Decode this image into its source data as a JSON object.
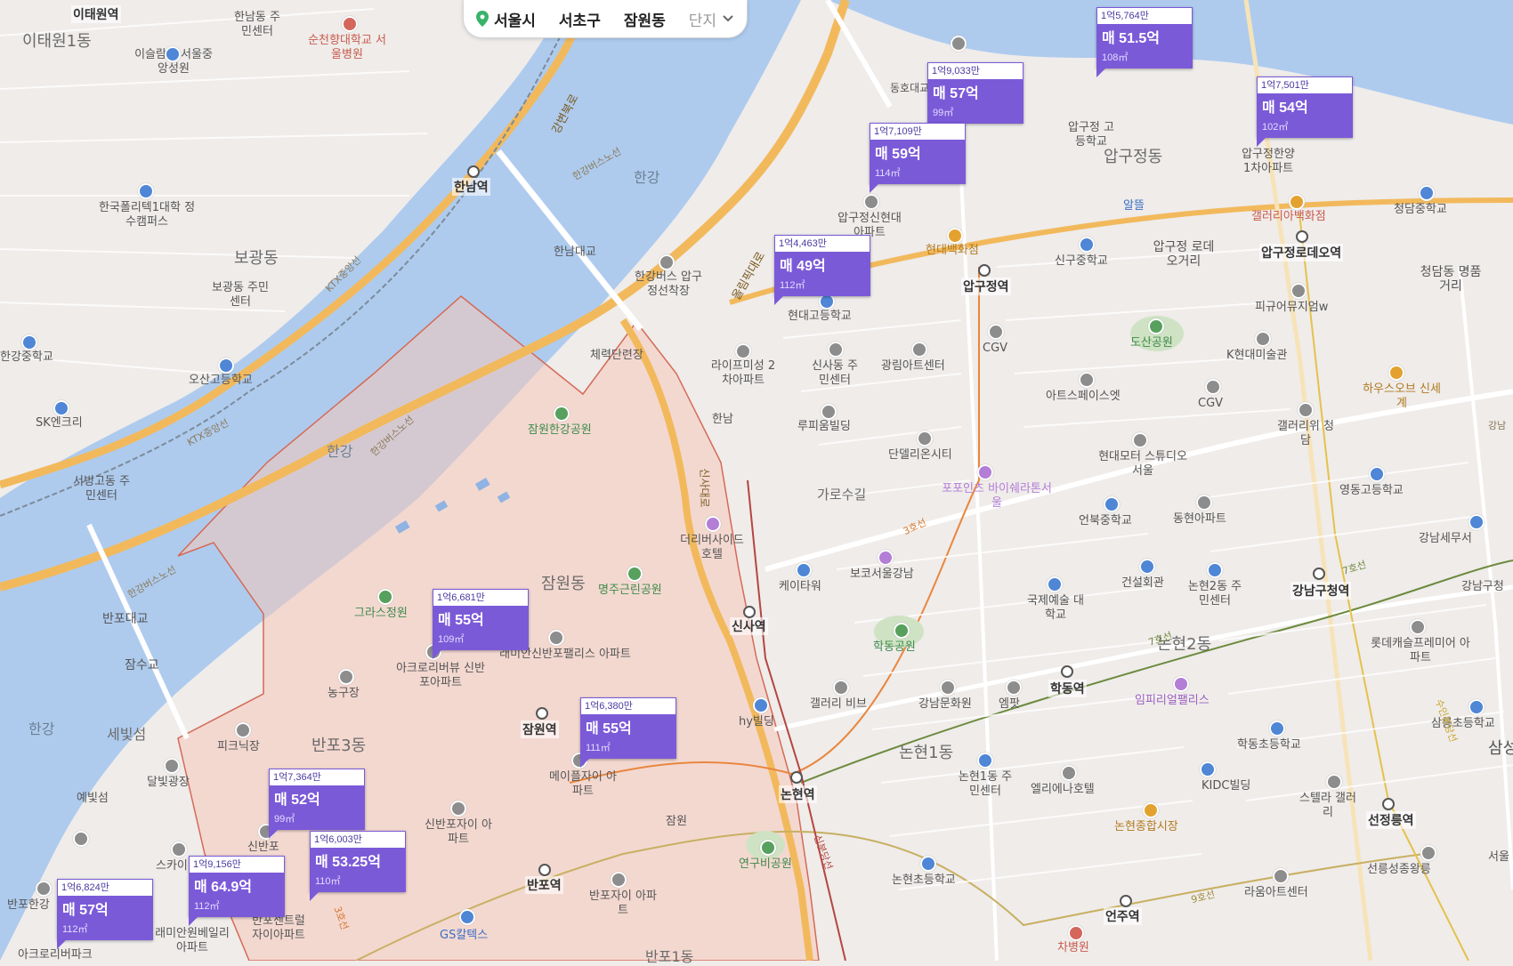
{
  "search": {
    "crumbs": [
      "서울시",
      "서초구",
      "잠원동",
      "단지"
    ]
  },
  "colors": {
    "water": "#aecbee",
    "land": "#efecea",
    "road_major": "#f2b95c",
    "district_fill": "#f6c9b9",
    "card": "#7b5ad8"
  },
  "listings": [
    {
      "per_pyeong": "1억5,764만",
      "price": "매 51.5억",
      "size": "108㎡"
    },
    {
      "per_pyeong": "1억9,033만",
      "price": "매 57억",
      "size": "99㎡"
    },
    {
      "per_pyeong": "1억7,501만",
      "price": "매 54억",
      "size": "102㎡"
    },
    {
      "per_pyeong": "1억7,109만",
      "price": "매 59억",
      "size": "114㎡"
    },
    {
      "per_pyeong": "1억4,463만",
      "price": "매 49억",
      "size": "112㎡"
    },
    {
      "per_pyeong": "1억6,681만",
      "price": "매 55억",
      "size": "109㎡"
    },
    {
      "per_pyeong": "1억6,380만",
      "price": "매 55억",
      "size": "111㎡"
    },
    {
      "per_pyeong": "1억7,364만",
      "price": "매 52억",
      "size": "99㎡"
    },
    {
      "per_pyeong": "1억6,003만",
      "price": "매 53.25억",
      "size": "110㎡"
    },
    {
      "per_pyeong": "1억9,156만",
      "price": "매 64.9억",
      "size": "112㎡"
    },
    {
      "per_pyeong": "1억6,824만",
      "price": "매 57억",
      "size": "112㎡"
    }
  ],
  "labels": {
    "areas": [
      "이태원1동",
      "보광동",
      "한강",
      "한강",
      "잠원동",
      "반포3동",
      "압구정동",
      "논현2동",
      "논현1동",
      "가로수길",
      "세빛섬",
      "한강",
      "반포1동"
    ],
    "stations": [
      "이태원역",
      "한남역",
      "압구정역",
      "신사역",
      "잠원역",
      "논현역",
      "학동역",
      "강남구청역",
      "선정릉역",
      "반포역",
      "언주역",
      "압구정로데오역"
    ],
    "pois": [
      "한남동 주민센터",
      "이슬람교 서울중앙성원",
      "순천향대학교 서울병원",
      "한국폴리텍1대학 정수캠퍼스",
      "보광동 주민센터",
      "한강중학교",
      "오산고등학교",
      "SK엔크리",
      "서빙고동 주민센터",
      "한남대교",
      "한강버스 압구정선착장",
      "현대고등학교",
      "라이프미성 2차아파트",
      "신사동 주민센터",
      "광림아트센터",
      "루피움빌딩",
      "단델리온시티",
      "체력단련장",
      "잠원한강공원",
      "더리버사이드 호텔",
      "명주근린공원",
      "래미안신반포팰리스 아파트",
      "그라스정원",
      "아크로리버뷰 신반포아파트",
      "농구장",
      "피크닉장",
      "달빛광장",
      "예빛섬",
      "메이플자이 아파트",
      "신반포자이 아파트",
      "반포자이 아파트",
      "GS칼텍스",
      "차병원",
      "반포대교",
      "잠수교",
      "압구정 고등학교",
      "압구정한양 1차아파트",
      "알뜰",
      "현대백화점",
      "신구중학교",
      "압구정 로데오거리",
      "갤러리아백화점",
      "청담중학교",
      "청담동 명품거리",
      "피규어뮤지엄w",
      "K현대미술관",
      "도산공원",
      "CGV",
      "CGV",
      "아트스페이스엣",
      "하우스오브 신세계",
      "갤러리위 청담",
      "현대모터 스튜디오서울",
      "포포인츠 바이쉐라톤서울",
      "언북중학교",
      "동현아파트",
      "영동고등학교",
      "강남세무서",
      "강남구청",
      "케이타워",
      "보코서울강남",
      "국제예술 대학교",
      "건설회관",
      "논현2동 주민센터",
      "롯데캐슬프레미어 아파트",
      "학동공원",
      "갤러리 비브",
      "강남문화원",
      "엠팟",
      "임피리얼팰리스",
      "삼릉초등학교",
      "학동초등학교",
      "hy빌딩",
      "논현1동 주민센터",
      "엘리에나호텔",
      "KIDC빌딩",
      "스텔라 갤러리",
      "논현종합시장",
      "연구비공원",
      "논현초등학교",
      "라움아트센터",
      "선릉성종왕릉",
      "압구정신현대 아파트",
      "한남",
      "잠원",
      "아크로리버파크",
      "래미안원베일리 아파트",
      "반포센트럴 자이아파트",
      "신반포",
      "스카이",
      "반포한강",
      "서울",
      "삼성"
    ],
    "roads": [
      "올림픽대로",
      "강변북로",
      "신사대로",
      "KTX중앙선",
      "한강버스노선",
      "한강버스노선",
      "한강버스노선",
      "3호선",
      "7호선",
      "7호선",
      "9호선",
      "신분당선",
      "수인분당선",
      "3호선",
      "동호대교",
      "KTX중앙선",
      "강남"
    ]
  }
}
